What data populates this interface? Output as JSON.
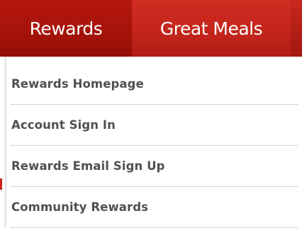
{
  "nav": {
    "tabs": [
      {
        "label": "Rewards",
        "active": true
      },
      {
        "label": "Great Meals",
        "active": false
      }
    ]
  },
  "dropdown": {
    "items": [
      {
        "label": "Rewards Homepage"
      },
      {
        "label": "Account Sign In"
      },
      {
        "label": "Rewards Email Sign Up"
      },
      {
        "label": "Community Rewards"
      }
    ]
  },
  "colors": {
    "nav_red": "#c8281e",
    "nav_active": "#a41209",
    "menu_text": "#505050",
    "divider": "#a9a9a9"
  }
}
